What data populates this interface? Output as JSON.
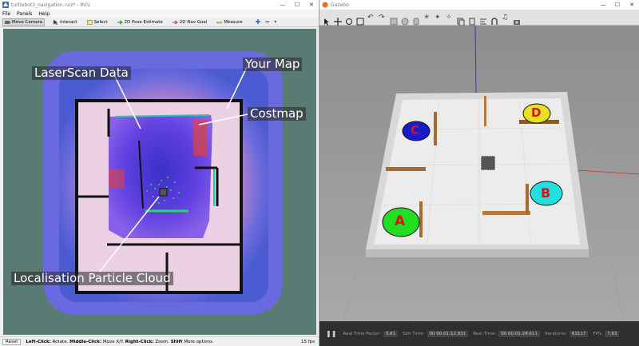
{
  "rviz": {
    "title": "turtlebot3_navigation.rviz* - RViz",
    "menu": [
      "File",
      "Panels",
      "Help"
    ],
    "tools": [
      {
        "label": "Move Camera",
        "icon": "camera-icon"
      },
      {
        "label": "Interact",
        "icon": "cursor-icon"
      },
      {
        "label": "Select",
        "icon": "select-icon"
      },
      {
        "label": "2D Pose Estimate",
        "icon": "pose-arrow-icon"
      },
      {
        "label": "2D Nav Goal",
        "icon": "goal-arrow-icon"
      },
      {
        "label": "Measure",
        "icon": "ruler-icon"
      }
    ],
    "status": {
      "reset": "Reset",
      "left": "Left-Click:",
      "left_desc": "Rotate.",
      "middle": "Middle-Click:",
      "middle_desc": "Move X/Y.",
      "right": "Right-Click:",
      "right_desc": "Zoom.",
      "shift": "Shift",
      "shift_desc": "More options.",
      "fps": "15 fps"
    },
    "annotations": {
      "laserscan": "LaserScan Data",
      "yourmap": "Your Map",
      "costmap": "Costmap",
      "particles": "Localisation Particle Cloud"
    }
  },
  "gazebo": {
    "title": "Gazebo",
    "markers": [
      "A",
      "B",
      "C",
      "D"
    ],
    "bottom": {
      "rtf_label": "Real Time Factor:",
      "rtf": "0.81",
      "sim_label": "Sim Time:",
      "sim": "00 00:01:12.831",
      "real_label": "Real Time:",
      "real": "00 00:01:24.611",
      "iter_label": "Iterations:",
      "iter": "63117",
      "fps_label": "FPS:",
      "fps": "7.63"
    }
  },
  "colors": {
    "marker_a": "#22dd22",
    "marker_b": "#22e0e0",
    "marker_c": "#1a1acc",
    "marker_d": "#e8e020",
    "marker_text": "#e01010",
    "costmap": "#5a4aee",
    "particles": "#22dd55"
  }
}
